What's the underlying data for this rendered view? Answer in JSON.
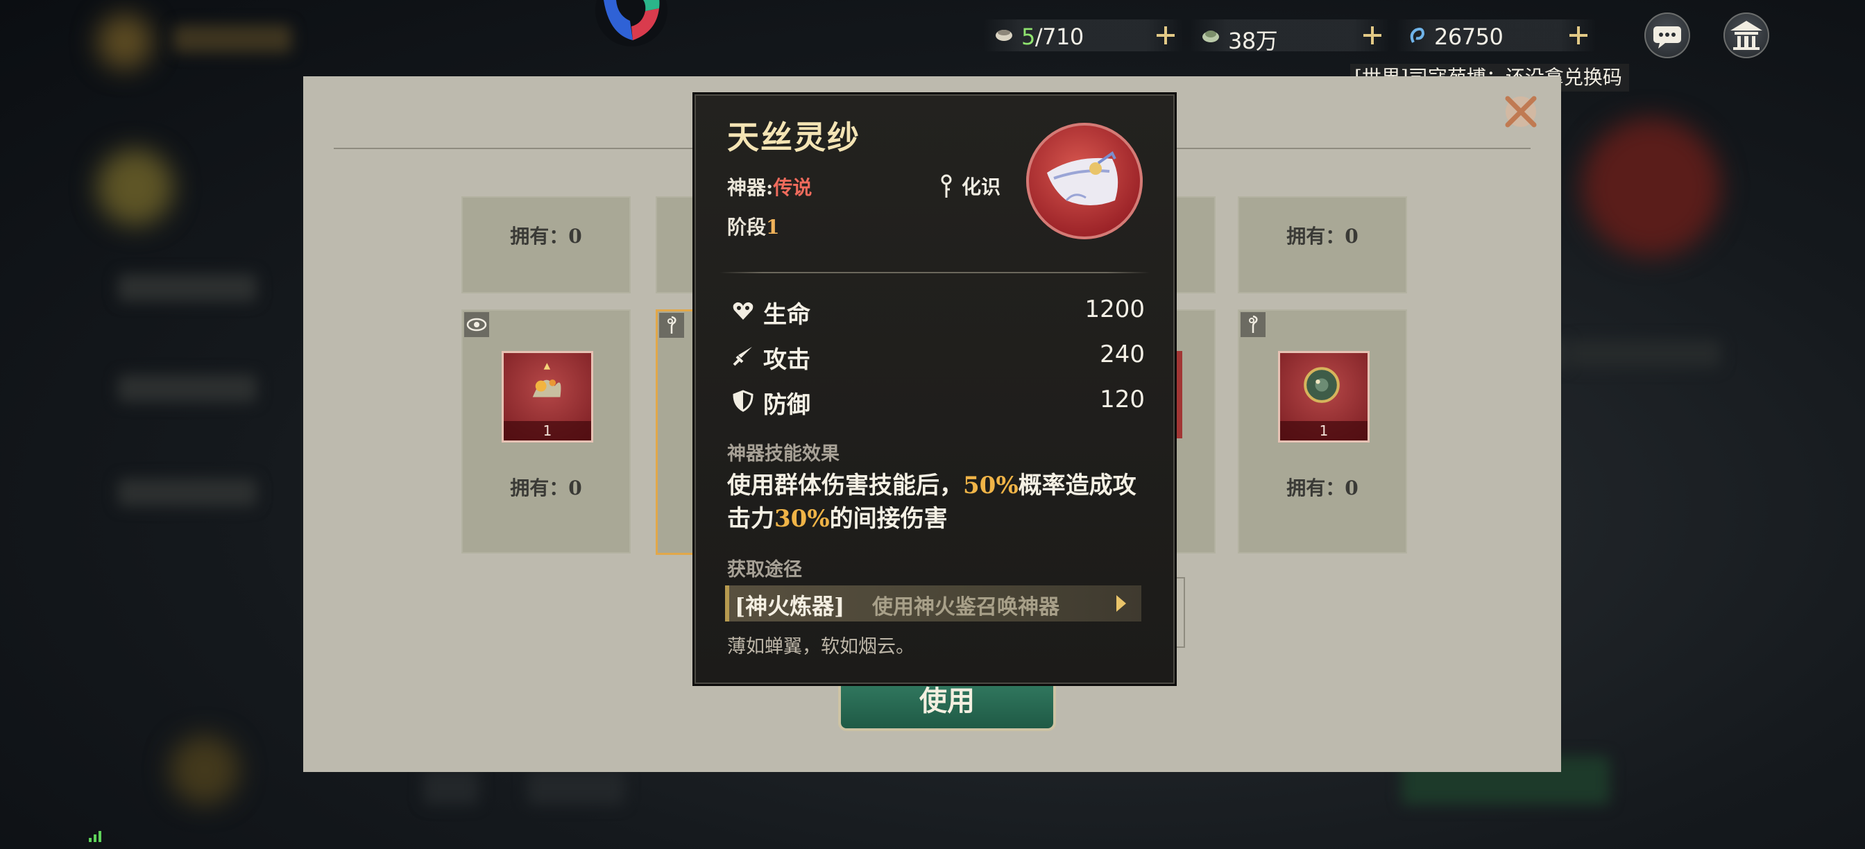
{
  "hud": {
    "stamina": {
      "current": "5",
      "max": "/710",
      "icon": "bowl-icon"
    },
    "copper": {
      "value": "38万",
      "icon": "coin-icon"
    },
    "jade": {
      "value": "26750",
      "icon": "jade-icon"
    }
  },
  "chat": {
    "line": "[世界]司寇苑博：还没拿兑换码"
  },
  "grid": {
    "own_label": "拥有：0",
    "cards": [
      {
        "own": "拥有：0"
      },
      {
        "own": "拥有：0"
      },
      {
        "own": "拥有：0"
      },
      {
        "own": "拥有：0"
      }
    ],
    "tiles": [
      {
        "level": "1"
      },
      {
        "level": "1"
      }
    ]
  },
  "use_button": "使用",
  "tooltip": {
    "name": "天丝灵纱",
    "type_label": "神器:",
    "type_value": "传说",
    "stage_label": "阶段",
    "stage_value": "1",
    "huashi": "化识",
    "stats": [
      {
        "name": "生命",
        "value": "1200",
        "icon": "heart-icon"
      },
      {
        "name": "攻击",
        "value": "240",
        "icon": "sword-icon"
      },
      {
        "name": "防御",
        "value": "120",
        "icon": "shield-icon"
      }
    ],
    "skill_header": "神器技能效果",
    "skill_part1": "使用群体伤害技能后，",
    "skill_hl1": "50%",
    "skill_part2": "概率造成攻击力",
    "skill_hl2": "30%",
    "skill_part3": "的间接伤害",
    "source_header": "获取途径",
    "source_name": "[神火炼器]",
    "source_how": "使用神火鉴召唤神器",
    "flavor": "薄如蝉翼，软如烟云。"
  },
  "colors": {
    "legendary": "#ef6b5c",
    "highlight": "#f0b447",
    "title": "#f4e4b4",
    "panel": "#bdbaae"
  }
}
